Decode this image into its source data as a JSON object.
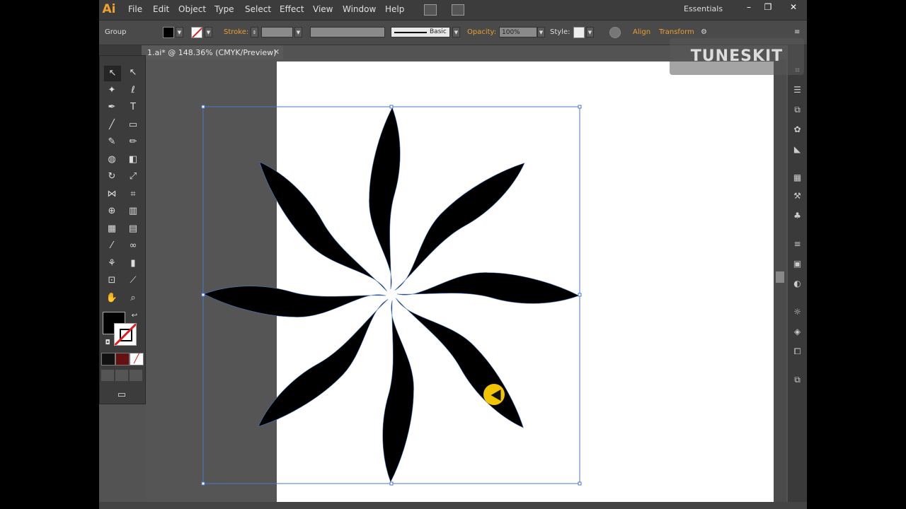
{
  "app": {
    "logo": "Ai"
  },
  "menubar": {
    "items": [
      "File",
      "Edit",
      "Object",
      "Type",
      "Select",
      "Effect",
      "View",
      "Window",
      "Help"
    ],
    "workspace": "Essentials",
    "window_buttons": [
      "–",
      "❐",
      "✕"
    ]
  },
  "controlbar": {
    "selection_type": "Group",
    "stroke_label": "Stroke:",
    "stroke_style": "Basic",
    "opacity_label": "Opacity:",
    "opacity_value": "100%",
    "style_label": "Style:",
    "align_label": "Align",
    "transform_label": "Transform",
    "accent_color": "#e8a030"
  },
  "document": {
    "tab_title": "1.ai* @ 148.36% (CMYK/Preview)",
    "close": "✕"
  },
  "tools": {
    "items": [
      {
        "name": "selection-tool",
        "glyph": "↖"
      },
      {
        "name": "direct-selection-tool",
        "glyph": "↖"
      },
      {
        "name": "magic-wand-tool",
        "glyph": "✦"
      },
      {
        "name": "lasso-tool",
        "glyph": "ℓ"
      },
      {
        "name": "pen-tool",
        "glyph": "✒"
      },
      {
        "name": "type-tool",
        "glyph": "T"
      },
      {
        "name": "line-tool",
        "glyph": "╱"
      },
      {
        "name": "rectangle-tool",
        "glyph": "▭"
      },
      {
        "name": "paintbrush-tool",
        "glyph": "✎"
      },
      {
        "name": "pencil-tool",
        "glyph": "✏"
      },
      {
        "name": "blob-brush-tool",
        "glyph": "◍"
      },
      {
        "name": "eraser-tool",
        "glyph": "◧"
      },
      {
        "name": "rotate-tool",
        "glyph": "↻"
      },
      {
        "name": "scale-tool",
        "glyph": "⤢"
      },
      {
        "name": "width-tool",
        "glyph": "⋈"
      },
      {
        "name": "free-transform-tool",
        "glyph": "⌗"
      },
      {
        "name": "shape-builder-tool",
        "glyph": "⊕"
      },
      {
        "name": "graph-tool",
        "glyph": "▥"
      },
      {
        "name": "mesh-tool",
        "glyph": "▦"
      },
      {
        "name": "gradient-tool",
        "glyph": "▤"
      },
      {
        "name": "eyedropper-tool",
        "glyph": "⁄"
      },
      {
        "name": "blend-tool",
        "glyph": "∞"
      },
      {
        "name": "symbol-sprayer-tool",
        "glyph": "⚘"
      },
      {
        "name": "column-graph-tool",
        "glyph": "▮"
      },
      {
        "name": "artboard-tool",
        "glyph": "⊡"
      },
      {
        "name": "slice-tool",
        "glyph": "⟋"
      },
      {
        "name": "hand-tool",
        "glyph": "✋"
      },
      {
        "name": "zoom-tool",
        "glyph": "⌕"
      }
    ]
  },
  "watermark": {
    "text": "TUNESKIT"
  },
  "colors": {
    "fill": "#000000",
    "stroke": "none",
    "selection": "#4a78c8"
  }
}
